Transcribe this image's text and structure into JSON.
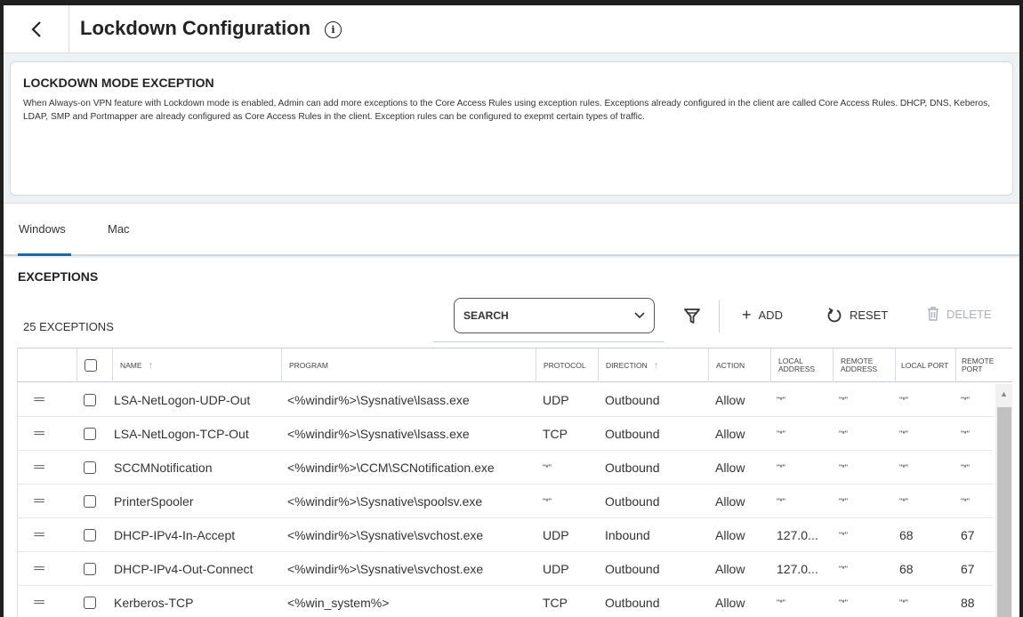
{
  "header": {
    "title": "Lockdown Configuration",
    "info_glyph": "i"
  },
  "card": {
    "title": "LOCKDOWN MODE EXCEPTION",
    "description": "When Always-on VPN feature with Lockdown mode is enabled, Admin can add more exceptions to the Core Access Rules using exception rules. Exceptions already configured in the client are called Core Access Rules. DHCP, DNS, Keberos, LDAP, SMP and Portmapper are already configured as Core Access Rules in the client. Exception rules can be configured to exepmt certain types of traffic."
  },
  "tabs": [
    {
      "label": "Windows",
      "active": true
    },
    {
      "label": "Mac",
      "active": false
    }
  ],
  "exceptions": {
    "title": "EXCEPTIONS",
    "count_label": "25 EXCEPTIONS",
    "search": {
      "label": "SEARCH"
    },
    "toolbar": {
      "add_label": "ADD",
      "reset_label": "RESET",
      "delete_label": "DELETE"
    },
    "columns": {
      "name": "NAME",
      "program": "PROGRAM",
      "protocol": "PROTOCOL",
      "direction": "DIRECTION",
      "action": "ACTION",
      "local_address": "LOCAL ADDRESS",
      "remote_address": "REMOTE ADDRESS",
      "local_port": "LOCAL PORT",
      "remote_port": "REMOTE PORT"
    },
    "rows": [
      {
        "name": "LSA-NetLogon-UDP-Out",
        "program": "<%windir%>\\Sysnative\\lsass.exe",
        "protocol": "UDP",
        "direction": "Outbound",
        "action": "Allow",
        "local_address": "\"*\"",
        "remote_address": "\"*\"",
        "local_port": "\"*\"",
        "remote_port": "\"*\""
      },
      {
        "name": "LSA-NetLogon-TCP-Out",
        "program": "<%windir%>\\Sysnative\\lsass.exe",
        "protocol": "TCP",
        "direction": "Outbound",
        "action": "Allow",
        "local_address": "\"*\"",
        "remote_address": "\"*\"",
        "local_port": "\"*\"",
        "remote_port": "\"*\""
      },
      {
        "name": "SCCMNotification",
        "program": "<%windir%>\\CCM\\SCNotification.exe",
        "protocol": "\"*\"",
        "direction": "Outbound",
        "action": "Allow",
        "local_address": "\"*\"",
        "remote_address": "\"*\"",
        "local_port": "\"*\"",
        "remote_port": "\"*\""
      },
      {
        "name": "PrinterSpooler",
        "program": "<%windir%>\\Sysnative\\spoolsv.exe",
        "protocol": "\"*\"",
        "direction": "Outbound",
        "action": "Allow",
        "local_address": "\"*\"",
        "remote_address": "\"*\"",
        "local_port": "\"*\"",
        "remote_port": "\"*\""
      },
      {
        "name": "DHCP-IPv4-In-Accept",
        "program": "<%windir%>\\Sysnative\\svchost.exe",
        "protocol": "UDP",
        "direction": "Inbound",
        "action": "Allow",
        "local_address": "127.0...",
        "remote_address": "\"*\"",
        "local_port": "68",
        "remote_port": "67"
      },
      {
        "name": "DHCP-IPv4-Out-Connect",
        "program": "<%windir%>\\Sysnative\\svchost.exe",
        "protocol": "UDP",
        "direction": "Outbound",
        "action": "Allow",
        "local_address": "127.0...",
        "remote_address": "\"*\"",
        "local_port": "68",
        "remote_port": "67"
      },
      {
        "name": "Kerberos-TCP",
        "program": "<%win_system%>",
        "protocol": "TCP",
        "direction": "Outbound",
        "action": "Allow",
        "local_address": "\"*\"",
        "remote_address": "\"*\"",
        "local_port": "\"*\"",
        "remote_port": "88"
      }
    ]
  },
  "colors": {
    "accent": "#1b6aa7",
    "disabled": "#aab0b6"
  }
}
